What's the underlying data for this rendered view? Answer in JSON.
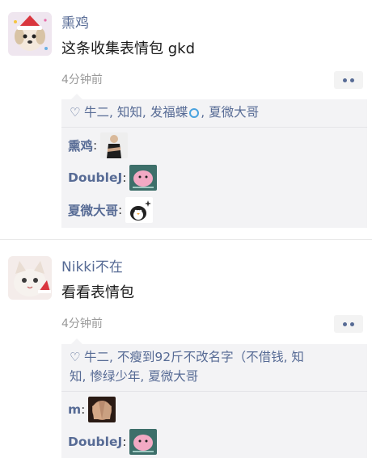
{
  "posts": [
    {
      "author": "熏鸡",
      "content": "这条收集表情包 gkd",
      "time": "4分钟前",
      "likes_prefix": "牛二, 知知, 发福蝶",
      "likes_suffix": ", 夏微大哥",
      "comments": [
        {
          "name": "熏鸡",
          "colon": ":",
          "sticker": "crossed-arms-person-sticker"
        },
        {
          "name": "DoubleJ",
          "colon": ":",
          "sticker": "pink-blob-sticker"
        },
        {
          "name": "夏微大哥",
          "colon": ":",
          "sticker": "penguin-sticker"
        }
      ]
    },
    {
      "author": "Nikki不在",
      "content": "看看表情包",
      "time": "4分钟前",
      "likes_line1": "牛二, 不瘦到92斤不改名字（不借钱, 知",
      "likes_line2": "知, 惨绿少年, 夏微大哥",
      "comments": [
        {
          "name": "m",
          "colon": ":",
          "sticker": "hands-covering-face-sticker"
        },
        {
          "name": "DoubleJ",
          "colon": ":",
          "sticker": "pink-blob-sticker"
        }
      ]
    }
  ],
  "icons": {
    "like": "heart-outline-icon",
    "more": "more-dots-icon"
  },
  "colors": {
    "name_link": "#576b95",
    "panel_bg": "#f3f3f5",
    "time": "#9a9a9a"
  }
}
